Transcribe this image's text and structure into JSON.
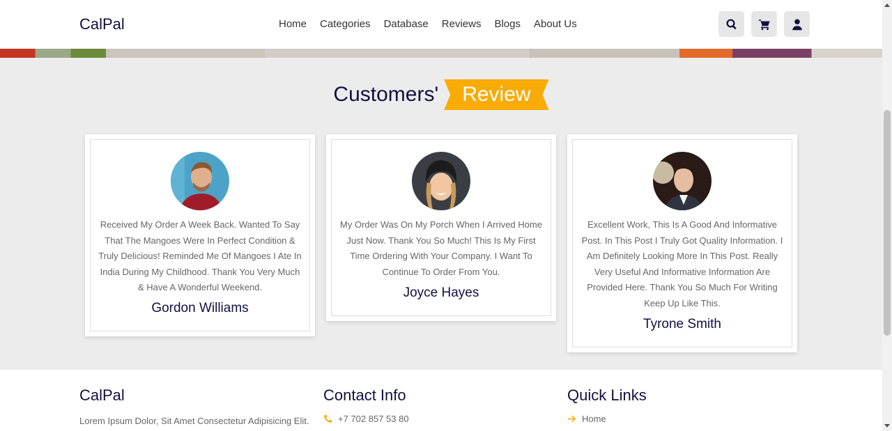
{
  "header": {
    "logo": "CalPal",
    "nav": [
      "Home",
      "Categories",
      "Database",
      "Reviews",
      "Blogs",
      "About Us"
    ],
    "icons": [
      "search-icon",
      "cart-icon",
      "user-icon"
    ]
  },
  "section": {
    "title_main": "Customers'",
    "title_highlight": "Review"
  },
  "reviews": [
    {
      "text": "Received My Order A Week Back. Wanted To Say That The Mangoes Were In Perfect Condition & Truly Delicious! Reminded Me Of Mangoes I Ate In India During My Childhood. Thank You Very Much & Have A Wonderful Weekend.",
      "name": "Gordon Williams"
    },
    {
      "text": "My Order Was On My Porch When I Arrived Home Just Now. Thank You So Much! This Is My First Time Ordering With Your Company. I Want To Continue To Order From You.",
      "name": "Joyce Hayes"
    },
    {
      "text": "Excellent Work, This Is A Good And Informative Post. In This Post I Truly Got Quality Information. I Am Definitely Looking More In This Post. Really Very Useful And Informative Information Are Provided Here. Thank You So Much For Writing Keep Up Like This.",
      "name": "Tyrone Smith"
    }
  ],
  "footer": {
    "brand": {
      "title": "CalPal",
      "text": "Lorem Ipsum Dolor, Sit Amet Consectetur Adipisicing Elit."
    },
    "contact": {
      "title": "Contact Info",
      "phone": "+7 702 857 53 80"
    },
    "links": {
      "title": "Quick Links",
      "first": "Home"
    }
  },
  "colors": {
    "accent": "#f9ab07",
    "heading": "#130f40"
  }
}
